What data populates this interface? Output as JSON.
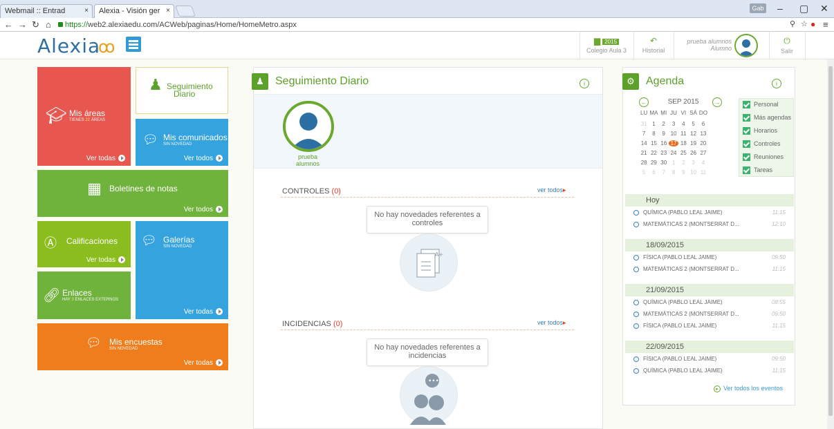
{
  "browser": {
    "tabs": [
      {
        "label": "Webmail :: Entrad",
        "close": "×"
      },
      {
        "label": "Alexia - Visión ger",
        "close": "×"
      }
    ],
    "user_badge": "Gab",
    "url_https": "https://",
    "url_rest": "web2.alexiaedu.com/ACWeb/paginas/Home/HomeMetro.aspx"
  },
  "header": {
    "logo": "Alexia",
    "school": "Colegio Aula 3",
    "year": "2015",
    "historial": "Historial",
    "user_name": "prueba alumnos",
    "user_role": "Alumno",
    "salir": "Salir"
  },
  "tiles": {
    "mis_areas": {
      "title": "Mis áreas",
      "sub_pre": "TIENES",
      "sub_num": "22",
      "sub_post": "ÁREAS",
      "more": "Ver todas"
    },
    "seguimiento": {
      "title1": "Seguimiento",
      "title2": "Diario"
    },
    "comunicados": {
      "title": "Mis comunicados",
      "sub": "SIN NOVEDAD",
      "more": "Ver todos"
    },
    "boletines": {
      "title": "Boletines de notas",
      "more": "Ver todos"
    },
    "calificaciones": {
      "title": "Calificaciones",
      "more": "Ver todas"
    },
    "galerias": {
      "title": "Galerías",
      "sub": "SIN NOVEDAD",
      "more": "Ver todas"
    },
    "enlaces": {
      "title": "Enlaces",
      "sub_pre": "HAY",
      "sub_num": "3",
      "sub_post": "ENLACES EXTERNOS"
    },
    "encuestas": {
      "title": "Mis encuestas",
      "sub": "SIN NOVEDAD",
      "more": "Ver todas"
    }
  },
  "seguimiento": {
    "title": "Seguimiento Diario",
    "student1": "prueba",
    "student2": "alumnos",
    "controles_label": "CONTROLES",
    "controles_count": "(0)",
    "controles_more": "ver todos",
    "controles_msg1": "No hay novedades referentes a",
    "controles_msg2": "controles",
    "incidencias_label": "INCIDENCIAS",
    "incidencias_count": "(0)",
    "incidencias_more": "ver todos",
    "incidencias_msg1": "No hay novedades referentes a",
    "incidencias_msg2": "incidencias"
  },
  "agenda": {
    "title": "Agenda",
    "month": "SEP 2015",
    "weekdays": [
      "LU",
      "MA",
      "MI",
      "JU",
      "VI",
      "SÁ",
      "DO"
    ],
    "weeks": [
      [
        "31",
        "1",
        "2",
        "3",
        "4",
        "5",
        "6"
      ],
      [
        "7",
        "8",
        "9",
        "10",
        "11",
        "12",
        "13"
      ],
      [
        "14",
        "15",
        "16",
        "17",
        "18",
        "19",
        "20"
      ],
      [
        "21",
        "22",
        "23",
        "24",
        "25",
        "26",
        "27"
      ],
      [
        "28",
        "29",
        "30",
        "1",
        "2",
        "3",
        "4"
      ],
      [
        "5",
        "6",
        "7",
        "8",
        "9",
        "10",
        "11"
      ]
    ],
    "filters": [
      "Personal",
      "Más agendas",
      "Horarios",
      "Controles",
      "Reuniones",
      "Tareas"
    ],
    "days": [
      {
        "label": "Hoy",
        "events": [
          {
            "name": "QUÍMICA (PABLO LEAL JAIME)",
            "time": "11:15"
          },
          {
            "name": "MATEMÁTICAS 2 (MONTSERRAT D...",
            "time": "12:10"
          }
        ]
      },
      {
        "label": "18/09/2015",
        "events": [
          {
            "name": "FÍSICA (PABLO LEAL JAIME)",
            "time": "09:50"
          },
          {
            "name": "MATEMÁTICAS 2 (MONTSERRAT D...",
            "time": "11:15"
          }
        ]
      },
      {
        "label": "21/09/2015",
        "events": [
          {
            "name": "QUÍMICA (PABLO LEAL JAIME)",
            "time": "08:55"
          },
          {
            "name": "MATEMÁTICAS 2 (MONTSERRAT D...",
            "time": "09:50"
          },
          {
            "name": "FÍSICA (PABLO LEAL JAIME)",
            "time": "11:15"
          }
        ]
      },
      {
        "label": "22/09/2015",
        "events": [
          {
            "name": "FÍSICA (PABLO LEAL JAIME)",
            "time": "09:50"
          },
          {
            "name": "QUÍMICA (PABLO LEAL JAIME)",
            "time": "11:15"
          }
        ]
      }
    ],
    "all_events": "Ver todos los eventos"
  },
  "colors": {
    "red": "#e8574f",
    "blue": "#35a4de",
    "green": "#6fb33d",
    "lime": "#8cbd1e",
    "orange": "#ef7d1c",
    "accent": "#5ca12a"
  }
}
